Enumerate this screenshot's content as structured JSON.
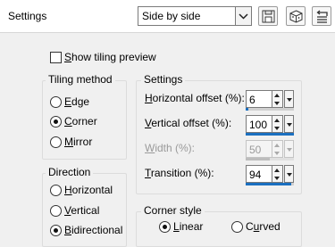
{
  "header": {
    "title": "Settings",
    "preset_select": {
      "value": "Side by side"
    },
    "buttons": [
      {
        "icon": "save-preset-icon"
      },
      {
        "icon": "randomize-icon"
      },
      {
        "icon": "reset-icon"
      }
    ]
  },
  "show_preview": {
    "label": "Show tiling preview",
    "checked": false
  },
  "tiling_method": {
    "title": "Tiling method",
    "options": [
      {
        "label": "Edge",
        "selected": false
      },
      {
        "label": "Corner",
        "selected": true
      },
      {
        "label": "Mirror",
        "selected": false
      }
    ]
  },
  "direction": {
    "title": "Direction",
    "options": [
      {
        "label": "Horizontal",
        "selected": false
      },
      {
        "label": "Vertical",
        "selected": false
      },
      {
        "label": "Bidirectional",
        "selected": true
      }
    ]
  },
  "settings": {
    "title": "Settings",
    "fields": [
      {
        "label": "Horizontal offset (%):",
        "value": "6",
        "percent": 6,
        "enabled": true
      },
      {
        "label": "Vertical offset (%):",
        "value": "100",
        "percent": 100,
        "enabled": true
      },
      {
        "label": "Width (%):",
        "value": "50",
        "percent": 50,
        "enabled": false
      },
      {
        "label": "Transition (%):",
        "value": "94",
        "percent": 94,
        "enabled": true
      }
    ]
  },
  "corner_style": {
    "title": "Corner style",
    "options": [
      {
        "label": "Linear",
        "selected": true
      },
      {
        "label": "Curved",
        "selected": false
      }
    ]
  },
  "colors": {
    "accent": "#1a6fc0",
    "panel": "#f0f0f0",
    "header": "#ffffff"
  }
}
